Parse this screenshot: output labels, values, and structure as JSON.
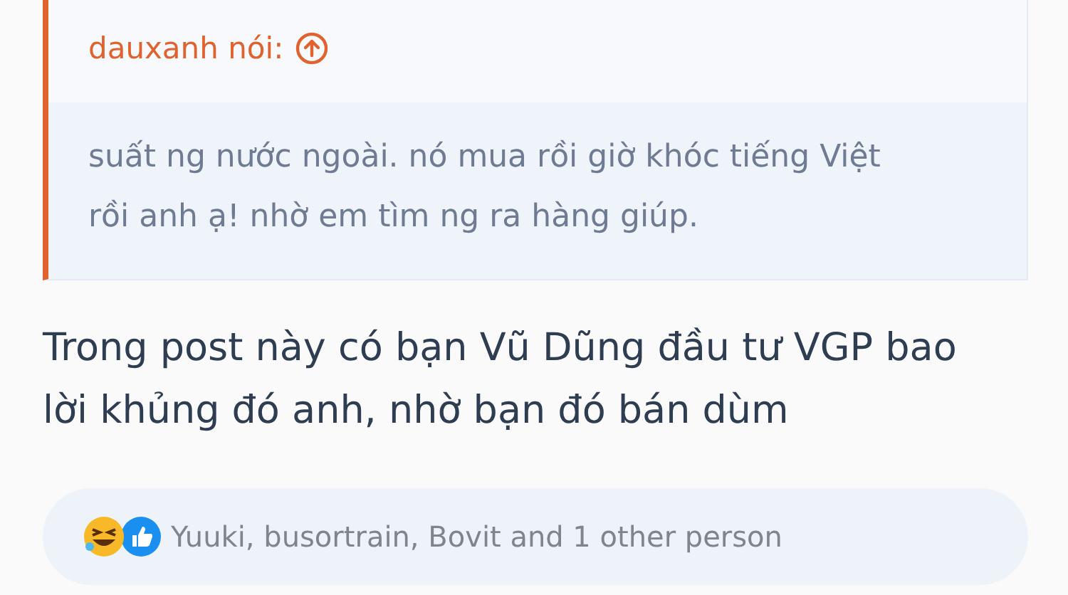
{
  "quote": {
    "author": "dauxanh nói:",
    "text": "suất ng nước ngoài. nó mua rồi giờ khóc tiếng Việt rồi anh ạ! nhờ em tìm ng ra hàng giúp."
  },
  "post": {
    "text": "Trong post này có bạn Vũ Dũng đầu tư VGP bao lời khủng đó anh, nhờ bạn đó bán dùm"
  },
  "reactions": {
    "icons": [
      {
        "kind": "haha"
      },
      {
        "kind": "like"
      }
    ],
    "text": "Yuuki, busortrain, Bovit and 1 other person"
  }
}
